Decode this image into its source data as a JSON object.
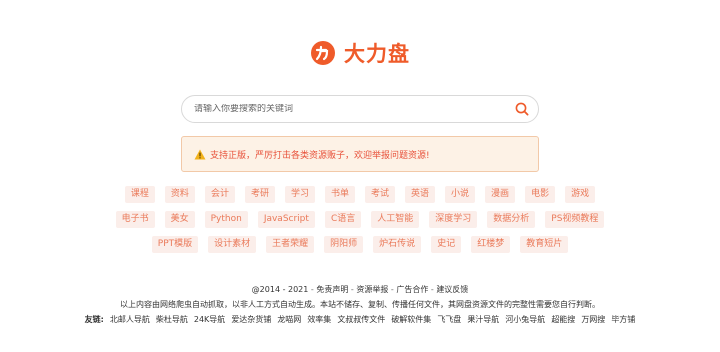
{
  "brand": {
    "name": "大力盘",
    "color": "#ef5b2a",
    "icon": "dali-logo-icon"
  },
  "search": {
    "placeholder": "请输入你要搜索的关键词",
    "icon": "search-icon"
  },
  "notice": {
    "icon": "warning-icon",
    "text": "支持正版，严厉打击各类资源贩子，欢迎举报问题资源!"
  },
  "tags": [
    [
      "课程",
      "资料",
      "会计",
      "考研",
      "学习",
      "书单",
      "考试",
      "英语",
      "小说",
      "漫画",
      "电影",
      "游戏"
    ],
    [
      "电子书",
      "美女",
      "Python",
      "JavaScript",
      "C语言",
      "人工智能",
      "深度学习",
      "数据分析",
      "PS视频教程"
    ],
    [
      "PPT模版",
      "设计素材",
      "王者荣耀",
      "阴阳师",
      "炉石传说",
      "史记",
      "红楼梦",
      "教育短片"
    ]
  ],
  "footer": {
    "copyright": "@2014 - 2021",
    "links": [
      "免责声明",
      "资源举报",
      "广告合作",
      "建议反馈"
    ],
    "separator": " - ",
    "disclaimer": "以上内容由网络爬虫自动抓取，以非人工方式自动生成。本站不储存、复制、传播任何文件，其网盘资源文件的完整性需要您自行判断。",
    "friends_label": "友链:",
    "friends": [
      "北邮人导航",
      "柴杜导航",
      "24K导航",
      "爱达杂货铺",
      "龙喵网",
      "效率集",
      "文叔叔传文件",
      "破解软件集",
      "飞飞盘",
      "果汁导航",
      "河小兔导航",
      "超能搜",
      "万网搜",
      "毕方铺"
    ]
  }
}
